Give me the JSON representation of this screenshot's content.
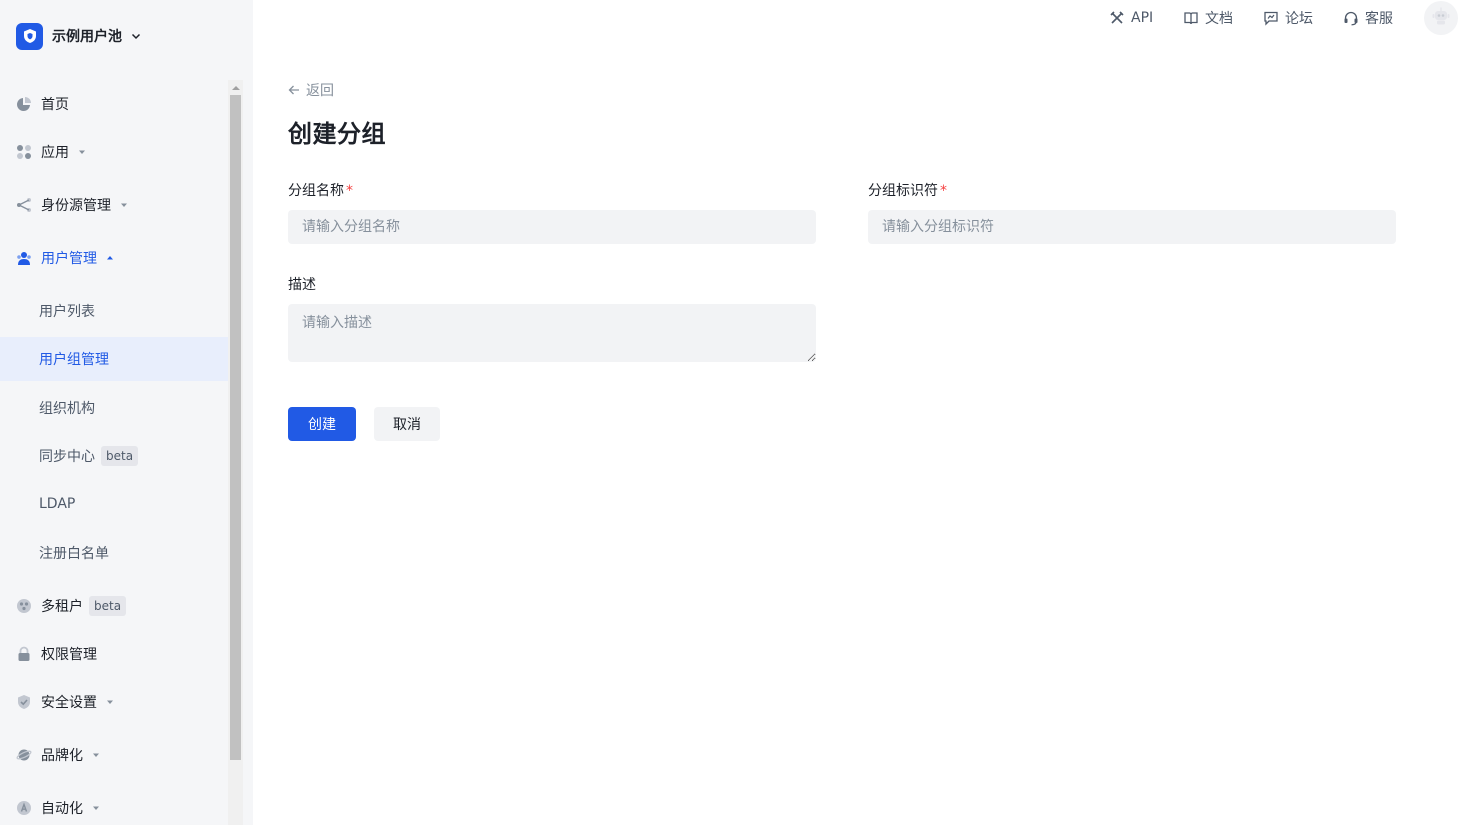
{
  "colors": {
    "accent": "#215ae5",
    "required": "#f53f3f",
    "sidebar_bg": "#f5f6f8",
    "selected_bg": "#e8eefc"
  },
  "pool": {
    "name": "示例用户池",
    "logo_icon": "shield-icon",
    "caret_icon": "chevron-down-icon"
  },
  "header": {
    "links": [
      {
        "label": "API",
        "icon": "tools-icon"
      },
      {
        "label": "文档",
        "icon": "book-icon"
      },
      {
        "label": "论坛",
        "icon": "chat-icon"
      },
      {
        "label": "客服",
        "icon": "headset-icon"
      }
    ],
    "avatar_icon": "robot-avatar-icon"
  },
  "sidebar": {
    "items": [
      {
        "label": "首页",
        "icon": "pie-chart-icon"
      },
      {
        "label": "应用",
        "icon": "apps-icon",
        "expandable": true
      },
      {
        "label": "身份源管理",
        "icon": "share-icon",
        "expandable": true
      },
      {
        "label": "用户管理",
        "icon": "users-icon",
        "expanded": true,
        "children": [
          {
            "label": "用户列表"
          },
          {
            "label": "用户组管理",
            "selected": true
          },
          {
            "label": "组织机构"
          },
          {
            "label": "同步中心",
            "badge": "beta"
          },
          {
            "label": "LDAP"
          },
          {
            "label": "注册白名单"
          }
        ]
      },
      {
        "label": "多租户",
        "icon": "tenant-icon",
        "badge": "beta"
      },
      {
        "label": "权限管理",
        "icon": "lock-icon"
      },
      {
        "label": "安全设置",
        "icon": "shield-check-icon",
        "expandable": true
      },
      {
        "label": "品牌化",
        "icon": "planet-icon",
        "expandable": true
      },
      {
        "label": "自动化",
        "icon": "automation-icon",
        "expandable": true
      }
    ]
  },
  "page": {
    "back_label": "返回",
    "title": "创建分组",
    "form": {
      "name_label": "分组名称",
      "name_placeholder": "请输入分组名称",
      "code_label": "分组标识符",
      "code_placeholder": "请输入分组标识符",
      "required_mark": "*",
      "description_label": "描述",
      "description_placeholder": "请输入描述"
    },
    "buttons": {
      "create": "创建",
      "cancel": "取消"
    }
  }
}
